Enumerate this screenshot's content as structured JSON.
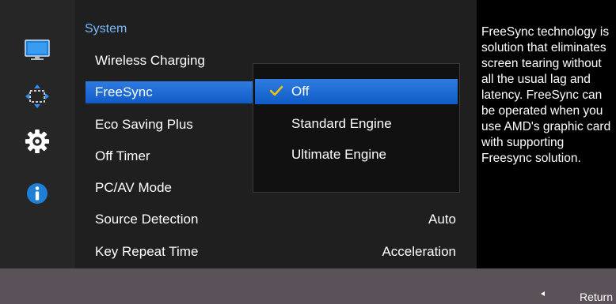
{
  "menu": {
    "title": "System",
    "items": [
      {
        "label": "Wireless Charging",
        "value": ""
      },
      {
        "label": "FreeSync",
        "value": ""
      },
      {
        "label": "Eco Saving Plus",
        "value": ""
      },
      {
        "label": "Off Timer",
        "value": ""
      },
      {
        "label": "PC/AV Mode",
        "value": ""
      },
      {
        "label": "Source Detection",
        "value": "Auto"
      },
      {
        "label": "Key Repeat Time",
        "value": "Acceleration"
      }
    ]
  },
  "submenu": {
    "options": [
      {
        "label": "Off",
        "checked": true
      },
      {
        "label": "Standard Engine",
        "checked": false
      },
      {
        "label": "Ultimate Engine",
        "checked": false
      }
    ]
  },
  "help": {
    "text": "FreeSync technology is solution that eliminates screen tearing without all the usual lag and latency. FreeSync can be operated when you use AMD's graphic card with supporting Freesync solution."
  },
  "footer": {
    "return_label": "Return"
  },
  "rail_icons": [
    "monitor-icon",
    "position-arrows-icon",
    "gear-icon",
    "info-icon"
  ],
  "colors": {
    "accent": "#1a6fe0",
    "title": "#7ab8ff",
    "background": "#262626",
    "bottom_bar": "#5a5258",
    "check": "#f5c400"
  }
}
